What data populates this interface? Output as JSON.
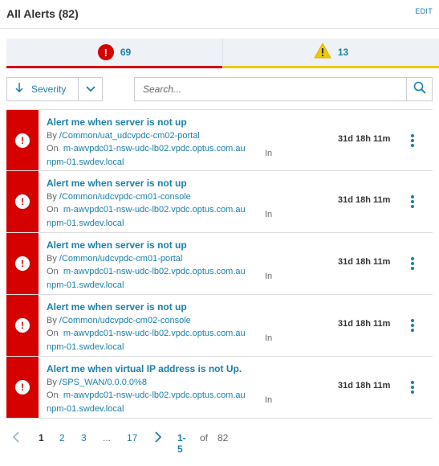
{
  "header": {
    "title": "All Alerts (82)",
    "edit_label": "EDIT"
  },
  "tabs": [
    {
      "count": "69",
      "severity": "critical",
      "color": "#d50000"
    },
    {
      "count": "13",
      "severity": "warning",
      "color": "#f0c800"
    }
  ],
  "sort": {
    "label": "Severity"
  },
  "search": {
    "placeholder": "Search..."
  },
  "labels": {
    "by": "By",
    "on": "On",
    "in": "In"
  },
  "alerts": [
    {
      "name": "Alert me when server is not up",
      "by": "/Common/uat_udcvpdc-cm02-portal",
      "on": "m-awvpdc01-nsw-udc-lb02.vpdc.optus.com.au",
      "in": "npm-01.swdev.local",
      "time": "31d 18h 11m"
    },
    {
      "name": "Alert me when server is not up",
      "by": "/Common/udcvpdc-cm01-console",
      "on": "m-awvpdc01-nsw-udc-lb02.vpdc.optus.com.au",
      "in": "npm-01.swdev.local",
      "time": "31d 18h 11m"
    },
    {
      "name": "Alert me when server is not up",
      "by": "/Common/udcvpdc-cm01-portal",
      "on": "m-awvpdc01-nsw-udc-lb02.vpdc.optus.com.au",
      "in": "npm-01.swdev.local",
      "time": "31d 18h 11m"
    },
    {
      "name": "Alert me when server is not up",
      "by": "/Common/udcvpdc-cm02-console",
      "on": "m-awvpdc01-nsw-udc-lb02.vpdc.optus.com.au",
      "in": "npm-01.swdev.local",
      "time": "31d 18h 11m"
    },
    {
      "name": "Alert me when virtual IP address is not Up.",
      "by": "/SPS_WAN/0.0.0.0%8",
      "on": "m-awvpdc01-nsw-udc-lb02.vpdc.optus.com.au",
      "in": "npm-01.swdev.local",
      "time": "31d 18h 11m"
    }
  ],
  "pagination": {
    "pages": [
      "1",
      "2",
      "3",
      "...",
      "17"
    ],
    "current": "1",
    "range": "1-5",
    "of_label": "of",
    "total": "82"
  },
  "colors": {
    "accent": "#1a7fa8",
    "critical": "#d50000",
    "warning": "#f0c800"
  }
}
